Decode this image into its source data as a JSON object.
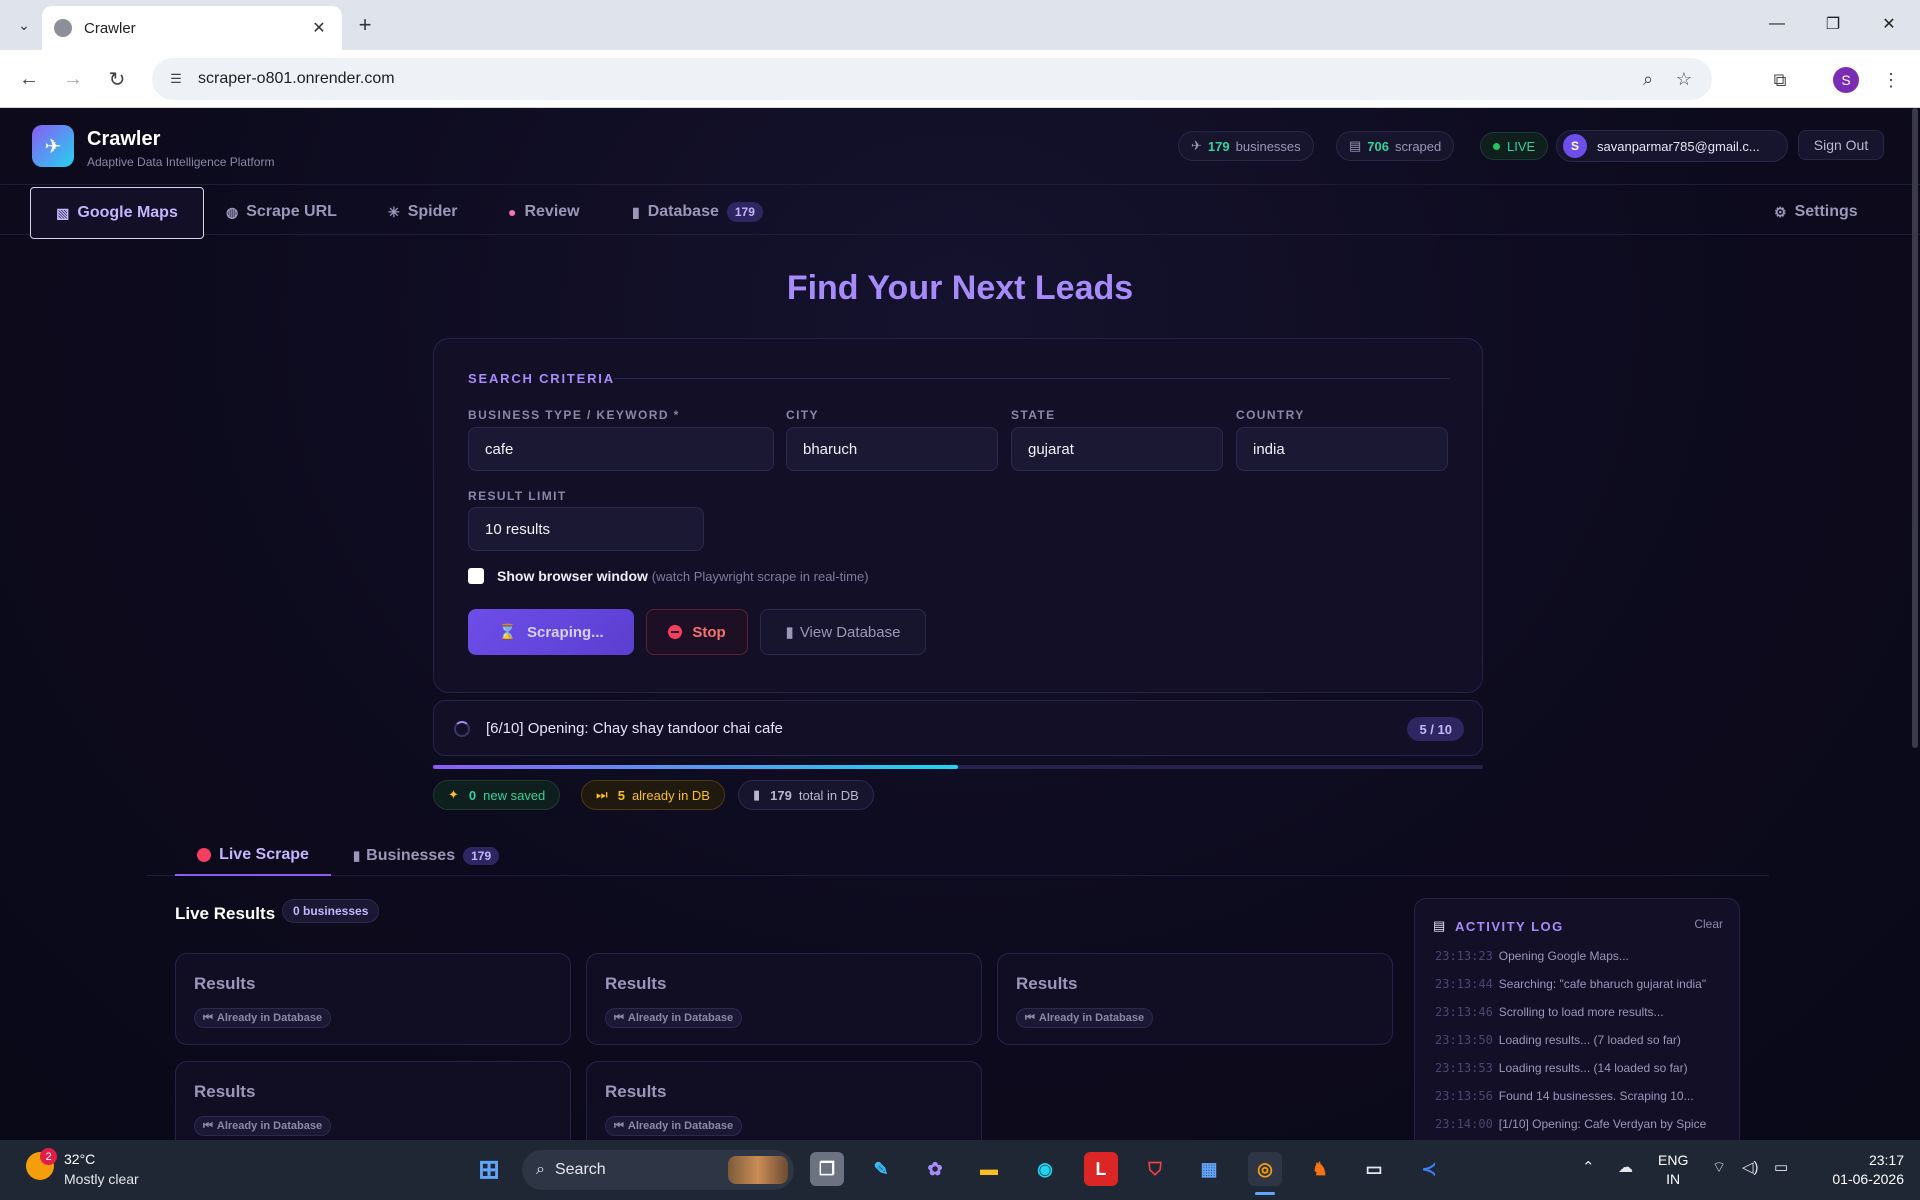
{
  "browser": {
    "tab_title": "Crawler",
    "url": "scraper-o801.onrender.com",
    "profile_initial": "S"
  },
  "header": {
    "brand": "Crawler",
    "tagline": "Adaptive Data Intelligence Platform",
    "businesses_count": "179",
    "businesses_label": "businesses",
    "scraped_count": "706",
    "scraped_label": "scraped",
    "live_label": "LIVE",
    "user_initial": "S",
    "user_email": "savanparmar785@gmail.c...",
    "signout_label": "Sign Out"
  },
  "nav": {
    "tabs": [
      {
        "label": "Google Maps",
        "icon": "map-icon"
      },
      {
        "label": "Scrape URL",
        "icon": "globe-icon"
      },
      {
        "label": "Spider",
        "icon": "spider-icon"
      },
      {
        "label": "Review",
        "icon": "brain-icon"
      },
      {
        "label": "Database",
        "icon": "database-icon",
        "badge": "179"
      }
    ],
    "settings_label": "Settings"
  },
  "hero_title": "Find Your Next Leads",
  "search": {
    "section_title": "SEARCH CRITERIA",
    "keyword_label": "BUSINESS TYPE / KEYWORD *",
    "keyword_value": "cafe",
    "city_label": "CITY",
    "city_value": "bharuch",
    "state_label": "STATE",
    "state_value": "gujarat",
    "country_label": "COUNTRY",
    "country_value": "india",
    "limit_label": "RESULT LIMIT",
    "limit_value": "10 results",
    "show_browser_label": "Show browser window",
    "show_browser_hint": "(watch Playwright scrape in real-time)",
    "scrape_button": "Scraping...",
    "stop_button": "Stop",
    "view_db_button": "View Database"
  },
  "progress": {
    "text": "[6/10] Opening: Chay shay tandoor chai cafe",
    "count": "5 / 10",
    "fraction": 0.5
  },
  "stats": {
    "new_saved_count": "0",
    "new_saved_label": "new saved",
    "already_count": "5",
    "already_label": "already in DB",
    "total_count": "179",
    "total_label": "total in DB"
  },
  "subtabs": {
    "live_label": "Live Scrape",
    "businesses_label": "Businesses",
    "businesses_badge": "179"
  },
  "results": {
    "title": "Live Results",
    "badge": "0 businesses",
    "cards": [
      {
        "title": "Results",
        "status": "Already in Database"
      },
      {
        "title": "Results",
        "status": "Already in Database"
      },
      {
        "title": "Results",
        "status": "Already in Database"
      },
      {
        "title": "Results",
        "status": "Already in Database"
      },
      {
        "title": "Results",
        "status": "Already in Database"
      }
    ]
  },
  "log": {
    "title": "ACTIVITY LOG",
    "clear_label": "Clear",
    "entries": [
      {
        "time": "23:13:23",
        "msg": "Opening Google Maps..."
      },
      {
        "time": "23:13:44",
        "msg": "Searching: \"cafe bharuch gujarat india\""
      },
      {
        "time": "23:13:46",
        "msg": "Scrolling to load more results..."
      },
      {
        "time": "23:13:50",
        "msg": "Loading results... (7 loaded so far)"
      },
      {
        "time": "23:13:53",
        "msg": "Loading results... (14 loaded so far)"
      },
      {
        "time": "23:13:56",
        "msg": "Found 14 businesses. Scraping 10..."
      },
      {
        "time": "23:14:00",
        "msg": "[1/10] Opening: Cafe Verdyan by Spice"
      }
    ]
  },
  "taskbar": {
    "weather_badge": "2",
    "temp": "32°C",
    "weather": "Mostly clear",
    "search_label": "Search",
    "lang_line1": "ENG",
    "lang_line2": "IN",
    "time": "23:17",
    "date": "01-06-2026"
  }
}
